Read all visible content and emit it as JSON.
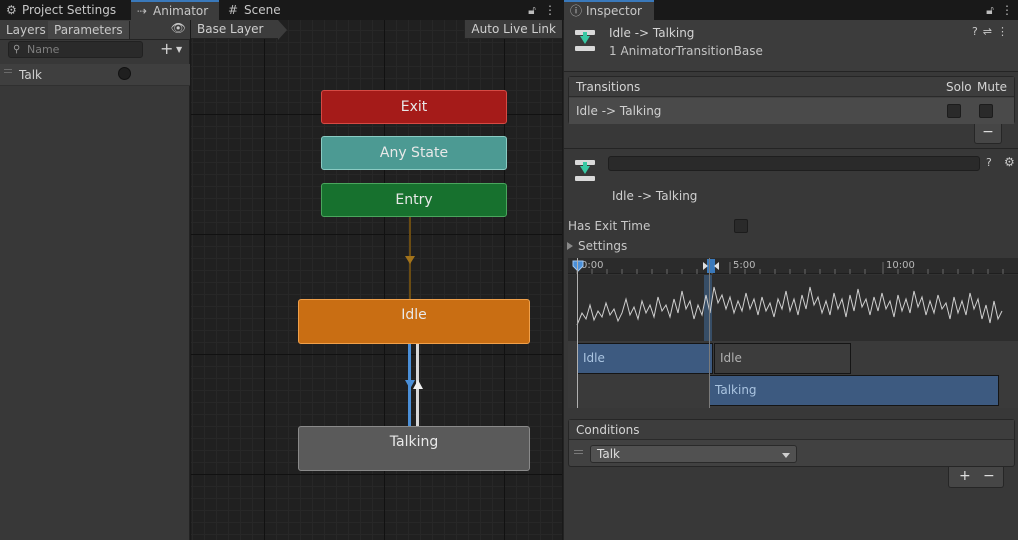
{
  "tabs": {
    "project_settings": "Project Settings",
    "animator": "Animator",
    "scene": "Scene",
    "inspector": "Inspector"
  },
  "parameters": {
    "tab_layers": "Layers",
    "tab_parameters": "Parameters",
    "search_placeholder": "Name",
    "items": [
      {
        "label": "Talk",
        "type": "trigger"
      }
    ]
  },
  "graph": {
    "breadcrumb": "Base Layer",
    "live_link": "Auto Live Link",
    "states": {
      "exit": "Exit",
      "any_state": "Any State",
      "entry": "Entry",
      "idle": "Idle",
      "talking": "Talking"
    }
  },
  "inspector": {
    "header_title": "Idle -> Talking",
    "header_subtitle": "1 AnimatorTransitionBase",
    "transitions": {
      "header": "Transitions",
      "solo": "Solo",
      "mute": "Mute",
      "row_label": "Idle -> Talking",
      "row_solo_checked": false,
      "row_mute_checked": false,
      "remove_btn": "−"
    },
    "transition_name_value": "",
    "transition_title": "Idle -> Talking",
    "has_exit_time_label": "Has Exit Time",
    "has_exit_time_checked": false,
    "settings_label": "Settings",
    "timeline": {
      "ticks": [
        "0:00",
        "5:00",
        "10:00"
      ],
      "clip_idle_1": "Idle",
      "clip_idle_2": "Idle",
      "clip_talking": "Talking"
    },
    "conditions": {
      "header": "Conditions",
      "selected_param": "Talk",
      "add_btn": "+",
      "remove_btn": "−"
    }
  },
  "colors": {
    "exit": "#a51b19",
    "any_state": "#4c9a93",
    "entry": "#17712e",
    "idle": "#c96e13",
    "talking": "#5a5a5a",
    "accent": "#3a79bb"
  }
}
